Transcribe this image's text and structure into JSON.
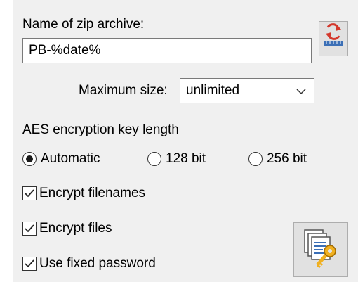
{
  "archive": {
    "name_label": "Name of zip archive:",
    "name_value": "PB-%date%",
    "refresh_icon": "refresh-icon"
  },
  "max_size": {
    "label": "Maximum size:",
    "value": "unlimited"
  },
  "aes": {
    "label": "AES encryption key length",
    "options": [
      "Automatic",
      "128 bit",
      "256 bit"
    ],
    "selected": "Automatic"
  },
  "checks": {
    "encrypt_filenames": "Encrypt filenames",
    "encrypt_files": "Encrypt files",
    "use_fixed_password": "Use fixed password"
  },
  "password_button_icon": "key-documents-icon",
  "colors": {
    "panel_bg": "#f0f0f0",
    "refresh_red": "#d4382c",
    "ruler_blue": "#3b6fb6",
    "key_gold": "#f0b020"
  }
}
